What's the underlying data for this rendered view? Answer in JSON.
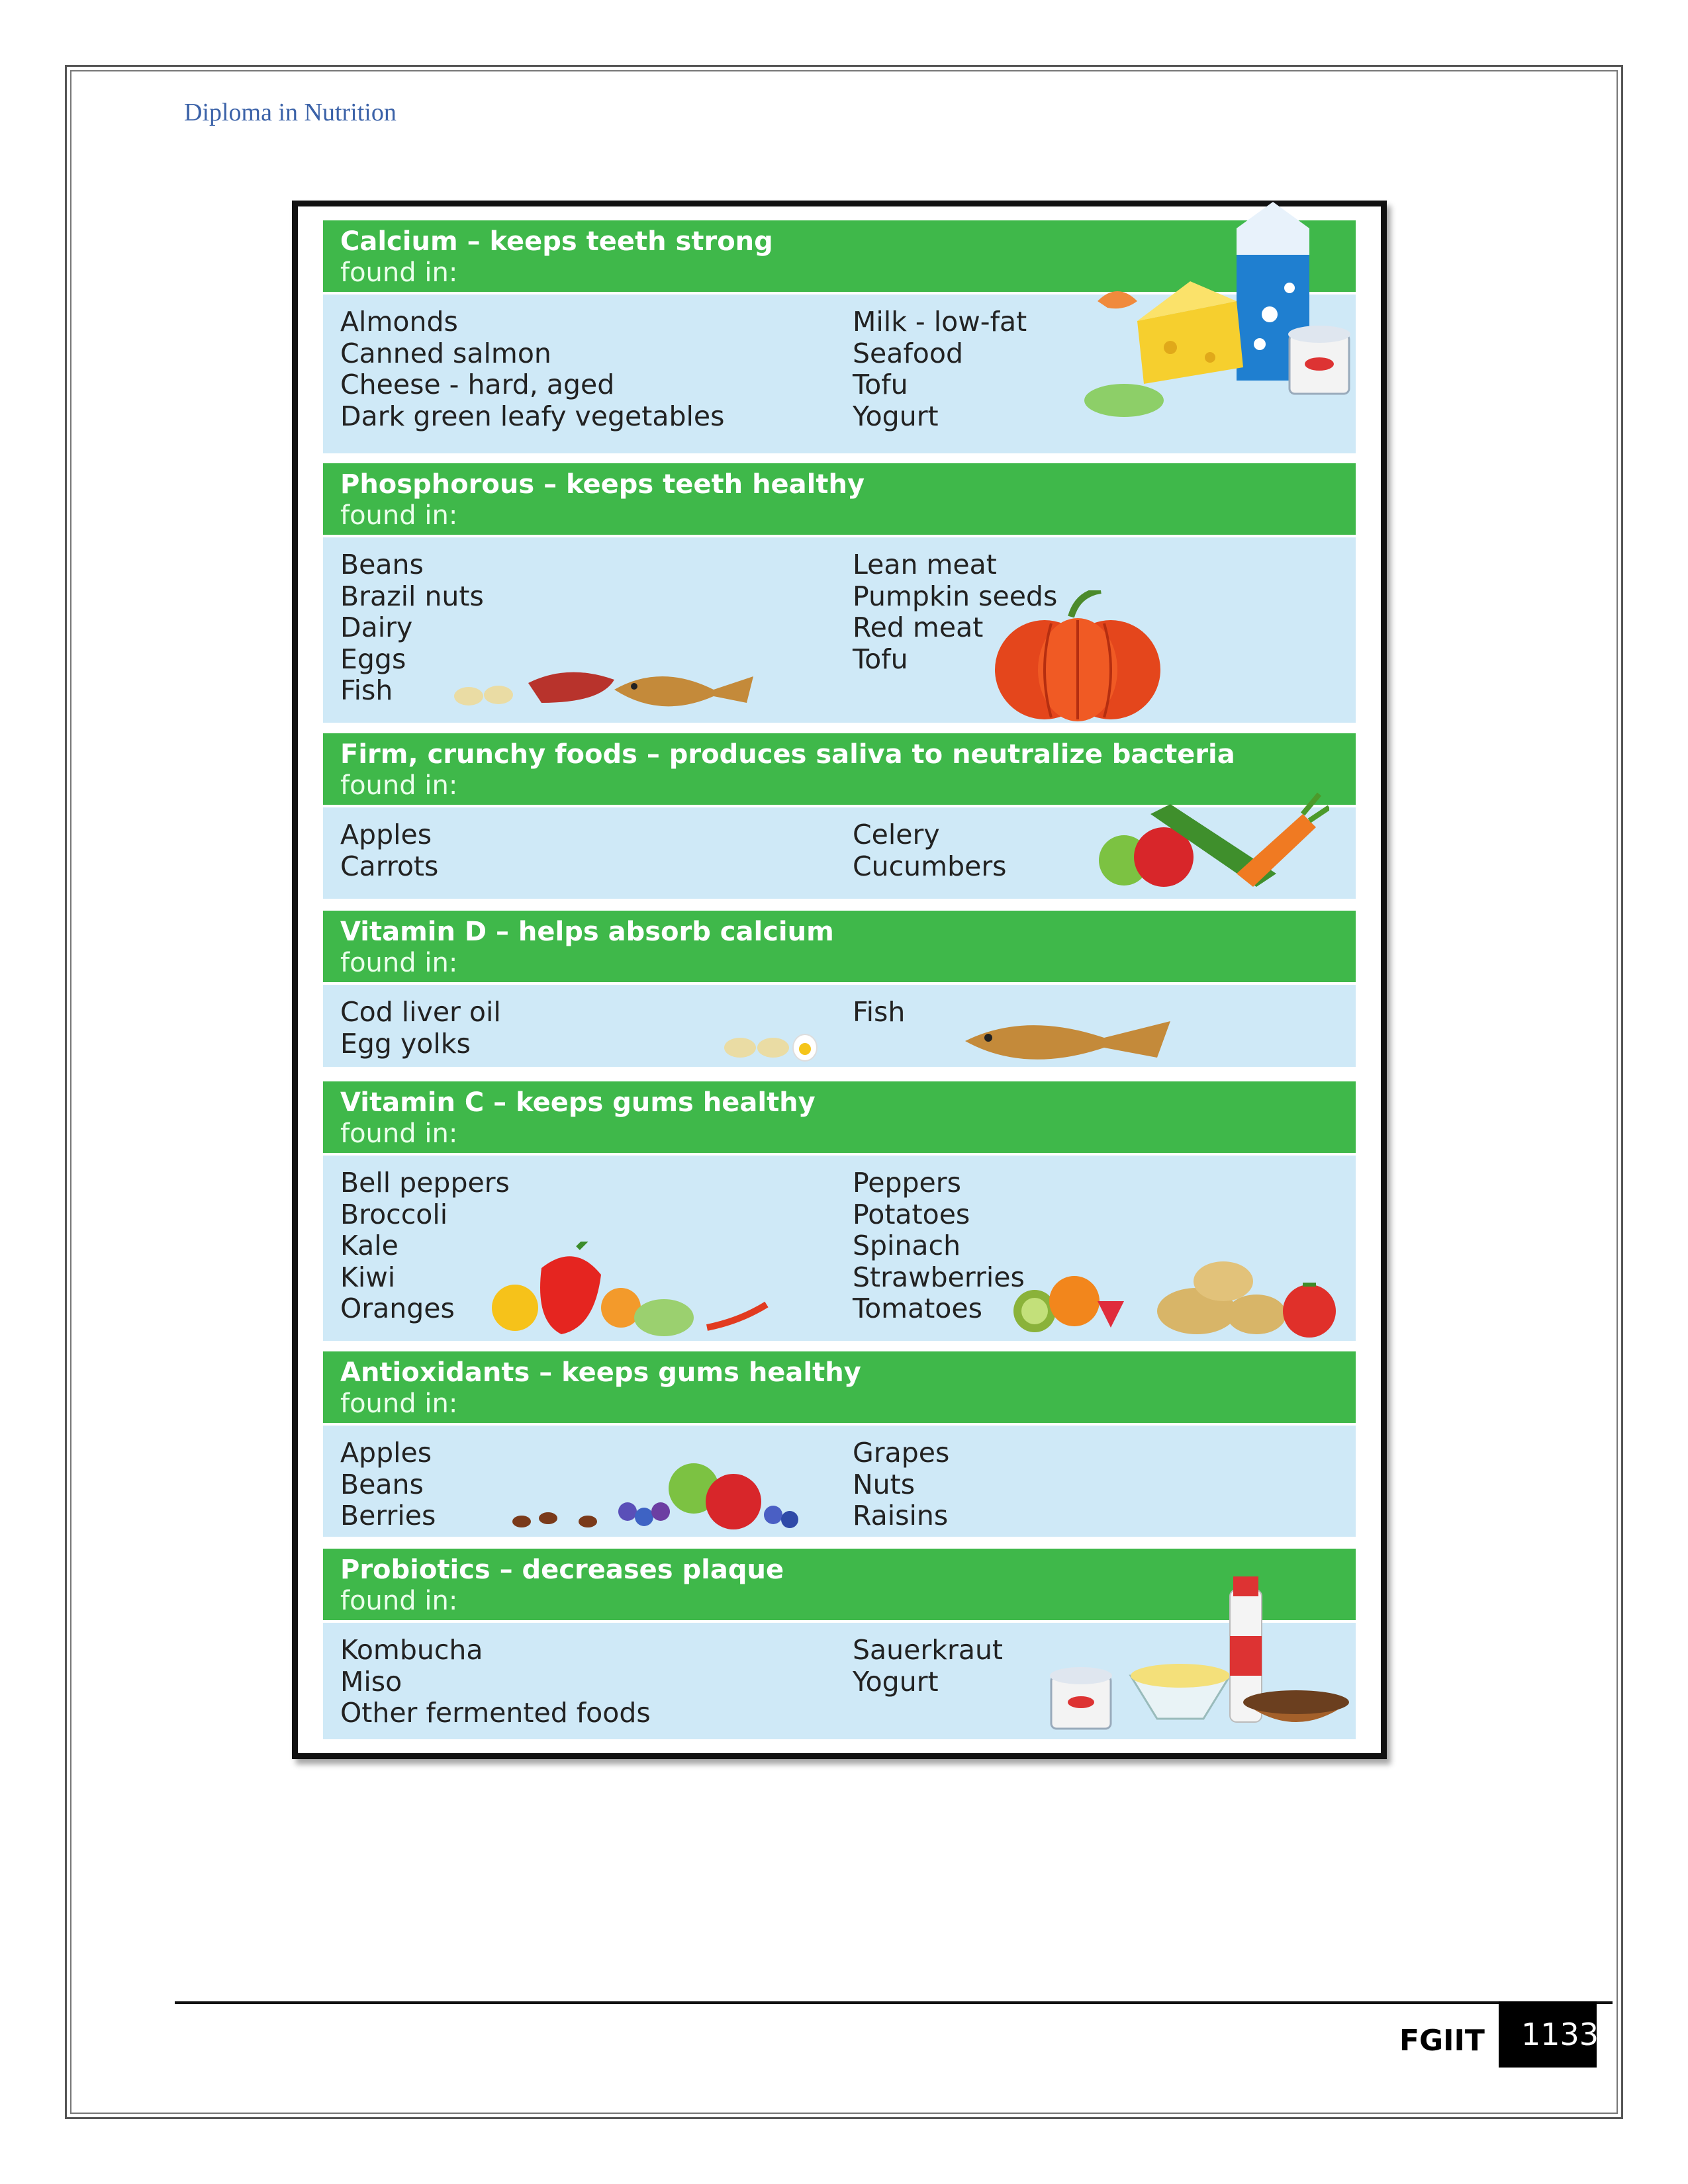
{
  "header": {
    "title": "Diploma in Nutrition"
  },
  "sections": [
    {
      "title": "Calcium – keeps teeth strong",
      "subtitle": "found in:",
      "left": [
        "Almonds",
        "Canned salmon",
        "Cheese - hard, aged",
        "Dark green leafy vegetables"
      ],
      "right": [
        "Milk - low-fat",
        "Seafood",
        "Tofu",
        "Yogurt"
      ]
    },
    {
      "title": "Phosphorous – keeps teeth healthy",
      "subtitle": "found in:",
      "left": [
        "Beans",
        "Brazil nuts",
        "Dairy",
        "Eggs",
        "Fish"
      ],
      "right": [
        "Lean meat",
        "Pumpkin seeds",
        "Red meat",
        "Tofu"
      ]
    },
    {
      "title": "Firm, crunchy foods – produces saliva to neutralize bacteria",
      "subtitle": "found in:",
      "left": [
        "Apples",
        "Carrots"
      ],
      "right": [
        "Celery",
        "Cucumbers"
      ]
    },
    {
      "title": "Vitamin D – helps absorb calcium",
      "subtitle": "found in:",
      "left": [
        "Cod liver oil",
        "Egg yolks"
      ],
      "right": [
        "Fish"
      ]
    },
    {
      "title": "Vitamin C – keeps gums healthy",
      "subtitle": "found in:",
      "left": [
        "Bell peppers",
        "Broccoli",
        "Kale",
        "Kiwi",
        "Oranges"
      ],
      "right": [
        "Peppers",
        "Potatoes",
        "Spinach",
        "Strawberries",
        "Tomatoes"
      ]
    },
    {
      "title": "Antioxidants – keeps gums healthy",
      "subtitle": "found in:",
      "left": [
        "Apples",
        "Beans",
        "Berries"
      ],
      "right": [
        "Grapes",
        "Nuts",
        "Raisins"
      ]
    },
    {
      "title": "Probiotics – decreases plaque",
      "subtitle": "found in:",
      "left": [
        "Kombucha",
        "Miso",
        "Other fermented foods"
      ],
      "right": [
        "Sauerkraut",
        "Yogurt"
      ]
    }
  ],
  "footer": {
    "organization": "FGIIT",
    "page_number": "1133"
  }
}
